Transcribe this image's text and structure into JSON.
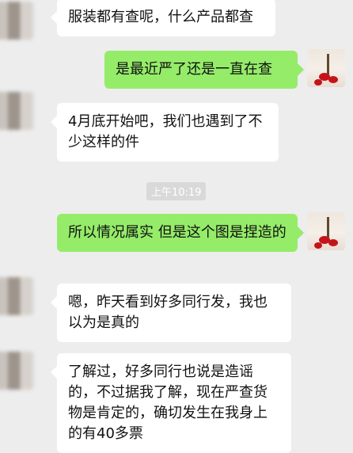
{
  "messages": [
    {
      "text": "服装都有查呢，什么产品都查"
    },
    {
      "text": "是最近严了还是一直在查"
    },
    {
      "text": "4月底开始吧，我们也遇到了不少这样的件"
    },
    {
      "text": "所以情况属实 但是这个图是捏造的"
    },
    {
      "text": "嗯，昨天看到好多同行发，我也以为是真的"
    },
    {
      "text": "了解过，好多同行也说是造谣的，不过据我了解，现在严查货物是肯定的，确切发生在我身上的有40多票"
    }
  ],
  "timestamp": "上午10:19",
  "colors": {
    "background": "#ededed",
    "incoming": "#ffffff",
    "outgoing": "#95ec69"
  }
}
